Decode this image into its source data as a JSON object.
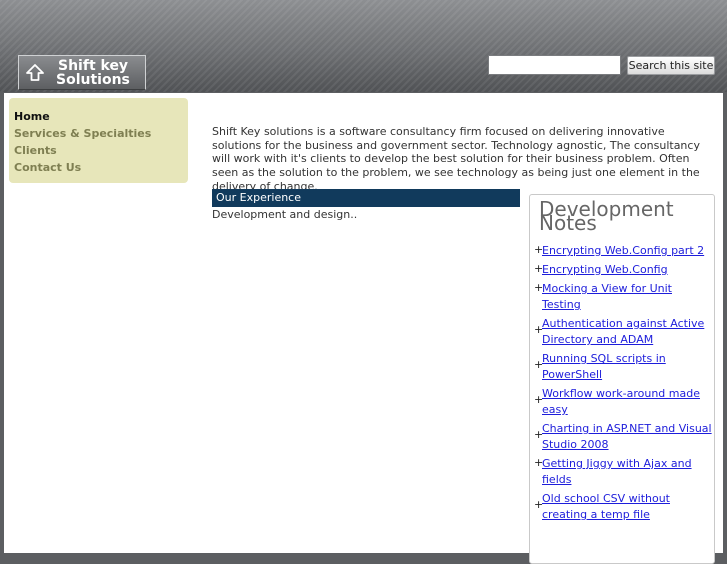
{
  "header": {
    "logo_line1": "Shift key",
    "logo_line2": "Solutions",
    "search_value": "",
    "search_button": "Search this site"
  },
  "nav": {
    "items": [
      {
        "label": "Home",
        "active": true
      },
      {
        "label": "Services & Specialties"
      },
      {
        "label": "Clients"
      },
      {
        "label": "Contact Us"
      }
    ]
  },
  "main": {
    "intro": "Shift Key solutions is a software consultancy firm focused on delivering innovative solutions for the business and government sector. Technology agnostic, The consultancy will work with it's clients to develop the best solution for their business problem. Often seen as the solution to the problem, we see technology as being just one element in the delivery of change.",
    "experience_title": "Our Experience",
    "experience_body": "Development and design.."
  },
  "notes": {
    "title": "Development Notes",
    "bullet": "+",
    "items": [
      "Encrypting Web.Config part 2",
      "Encrypting Web.Config",
      "Mocking a View for Unit Testing",
      "Authentication against Active Directory and ADAM",
      "Running SQL scripts in PowerShell",
      "Workflow work-around made easy",
      "Charting in ASP.NET and Visual Studio 2008",
      "Getting Jiggy with Ajax and fields",
      "Old school CSV without creating a temp file"
    ]
  }
}
